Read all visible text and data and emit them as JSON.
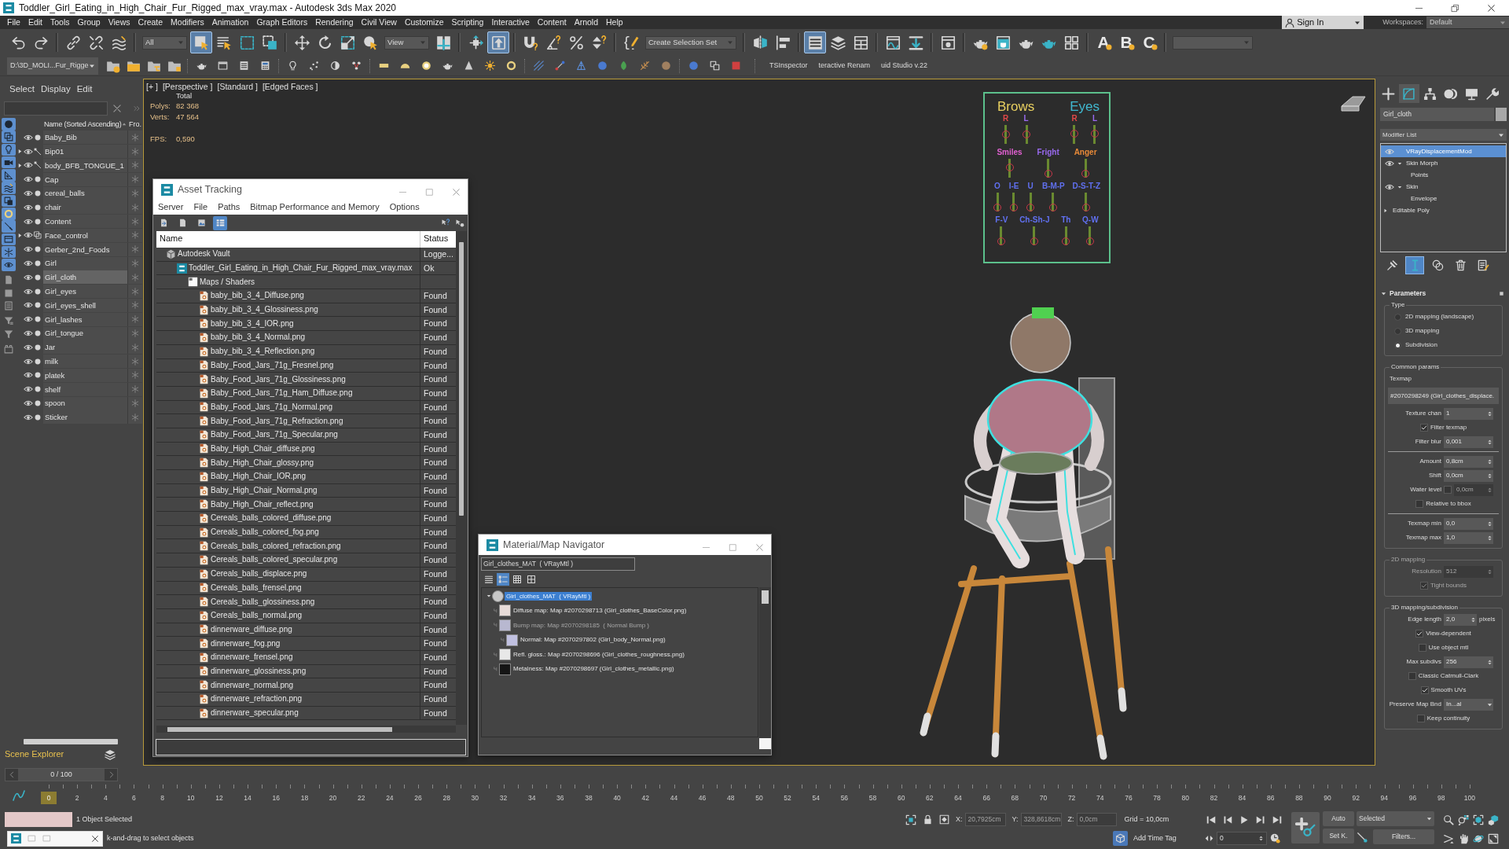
{
  "window": {
    "title": "Toddler_Girl_Eating_in_High_Chair_Fur_Rigged_max_vray.max - Autodesk 3ds Max 2020"
  },
  "menu": [
    "File",
    "Edit",
    "Tools",
    "Group",
    "Views",
    "Create",
    "Modifiers",
    "Animation",
    "Graph Editors",
    "Rendering",
    "Civil View",
    "Customize",
    "Scripting",
    "Interactive",
    "Content",
    "Arnold",
    "Help"
  ],
  "account": {
    "label": "Sign In"
  },
  "workspaces": {
    "label": "Workspaces:",
    "value": "Default"
  },
  "main_toolbar": [
    [
      {
        "kind": "undo",
        "on": false
      },
      {
        "kind": "redo",
        "on": false
      }
    ],
    [
      {
        "kind": "link",
        "on": false
      },
      {
        "kind": "unlink",
        "on": false
      },
      {
        "kind": "bind",
        "on": false
      }
    ],
    [
      {
        "kind": "dropdown",
        "value": "All",
        "on": false
      },
      {
        "kind": "select-object",
        "on": true
      },
      {
        "kind": "select-by-name",
        "on": false
      },
      {
        "kind": "region",
        "on": false
      },
      {
        "kind": "crossing",
        "on": false
      }
    ],
    [
      {
        "kind": "move",
        "on": false
      },
      {
        "kind": "rotate",
        "on": false
      },
      {
        "kind": "scale",
        "on": false
      },
      {
        "kind": "place",
        "on": false
      },
      {
        "kind": "dropdown",
        "value": "View",
        "on": false
      },
      {
        "kind": "pivot",
        "on": false
      }
    ],
    [
      {
        "kind": "manipulate",
        "on": false
      },
      {
        "kind": "shortcut-override",
        "on": true
      }
    ],
    [
      {
        "kind": "snap",
        "on": false
      },
      {
        "kind": "angle-snap",
        "on": false
      },
      {
        "kind": "percent-snap",
        "on": false
      },
      {
        "kind": "spinner-snap",
        "on": false
      }
    ],
    [
      {
        "kind": "named-selection",
        "on": false
      },
      {
        "kind": "dropdown",
        "value": "Create Selection Set",
        "on": false
      }
    ],
    [
      {
        "kind": "mirror",
        "on": false
      },
      {
        "kind": "align",
        "on": false
      }
    ],
    [
      {
        "kind": "scene-explorer",
        "on": true
      },
      {
        "kind": "layer-explorer",
        "on": false
      },
      {
        "kind": "ribbon",
        "on": false
      }
    ],
    [
      {
        "kind": "curve-editor",
        "on": false
      },
      {
        "kind": "schematic",
        "on": false
      }
    ],
    [
      {
        "kind": "material-editor",
        "on": false
      }
    ],
    [
      {
        "kind": "render-setup",
        "on": false
      },
      {
        "kind": "frame-window",
        "on": false
      },
      {
        "kind": "render",
        "on": false
      },
      {
        "kind": "render-iterative",
        "on": false
      },
      {
        "kind": "render-grid",
        "on": false
      }
    ],
    [
      {
        "kind": "preset",
        "label": "A",
        "on": false
      },
      {
        "kind": "preset",
        "label": "B",
        "on": false
      },
      {
        "kind": "preset",
        "label": "C",
        "on": false
      }
    ],
    [
      {
        "kind": "dropdown",
        "on": false
      }
    ]
  ],
  "secondary_toolbar": {
    "project": "D:\\3D_MOLI...Fur_Rigge",
    "groups": [
      [
        {
          "kind": "folder-gear"
        },
        {
          "kind": "folder"
        },
        {
          "kind": "folder-tree"
        },
        {
          "kind": "folder-tag"
        }
      ],
      [
        {
          "kind": "teapot"
        },
        {
          "kind": "window"
        },
        {
          "kind": "list"
        },
        {
          "kind": "calculator"
        }
      ],
      [
        {
          "kind": "bulb"
        },
        {
          "kind": "scatter"
        },
        {
          "kind": "half-circle"
        },
        {
          "kind": "nodes"
        }
      ],
      [
        {
          "kind": "bar"
        },
        {
          "kind": "dome"
        },
        {
          "kind": "sphere"
        },
        {
          "kind": "teapot"
        },
        {
          "kind": "cone"
        },
        {
          "kind": "sun"
        },
        {
          "kind": "ring"
        }
      ],
      [
        {
          "kind": "grid-dots"
        },
        {
          "kind": "molecule"
        },
        {
          "kind": "network"
        },
        {
          "kind": "ball"
        },
        {
          "kind": "leaf"
        },
        {
          "kind": "feather"
        },
        {
          "kind": "globe"
        }
      ],
      [
        {
          "kind": "ball"
        },
        {
          "kind": "windows"
        },
        {
          "kind": "square-dot"
        }
      ]
    ],
    "labels": [
      "TSInspector",
      "teractive Renam",
      "uid Studio v.22"
    ]
  },
  "scene_explorer": {
    "tabs": [
      "Select",
      "Display",
      "Edit"
    ],
    "columns": [
      "Name (Sorted Ascending)",
      "Fro."
    ],
    "filters": [
      [
        {
          "kind": "circle",
          "on": true
        },
        {
          "kind": "squares",
          "on": true
        },
        {
          "kind": "bulb",
          "on": true
        },
        {
          "kind": "camera",
          "on": true
        },
        {
          "kind": "ruler",
          "on": true
        },
        {
          "kind": "waves",
          "on": true
        },
        {
          "kind": "group-box",
          "on": true
        },
        {
          "kind": "ring",
          "on": true
        },
        {
          "kind": "pencil",
          "on": true
        },
        {
          "kind": "tray",
          "on": true
        },
        {
          "kind": "snowflake",
          "on": true
        },
        {
          "kind": "eye",
          "on": true
        }
      ],
      [
        {
          "kind": "document",
          "on": false
        },
        {
          "kind": "square",
          "on": false
        },
        {
          "kind": "doc-lines",
          "on": false
        }
      ],
      [
        {
          "kind": "funnel-lines",
          "on": false
        },
        {
          "kind": "funnel",
          "on": false
        }
      ],
      [
        {
          "kind": "container",
          "on": false
        }
      ]
    ],
    "items": [
      {
        "name": "Baby_Bib",
        "kind": "geometry",
        "expandable": false,
        "selected": false
      },
      {
        "name": "Bip01",
        "kind": "bone",
        "expandable": true,
        "selected": false
      },
      {
        "name": "body_BFB_TONGUE_1",
        "kind": "bone",
        "expandable": true,
        "selected": false
      },
      {
        "name": "Cap",
        "kind": "geometry",
        "expandable": false,
        "selected": false
      },
      {
        "name": "cereal_balls",
        "kind": "geometry",
        "expandable": false,
        "selected": false
      },
      {
        "name": "chair",
        "kind": "geometry",
        "expandable": false,
        "selected": false
      },
      {
        "name": "Content",
        "kind": "geometry",
        "expandable": false,
        "selected": false
      },
      {
        "name": "Face_control",
        "kind": "shape",
        "expandable": true,
        "selected": false
      },
      {
        "name": "Gerber_2nd_Foods",
        "kind": "geometry",
        "expandable": false,
        "selected": false
      },
      {
        "name": "Girl",
        "kind": "geometry",
        "expandable": false,
        "selected": false
      },
      {
        "name": "Girl_cloth",
        "kind": "geometry",
        "expandable": false,
        "selected": true
      },
      {
        "name": "Girl_eyes",
        "kind": "geometry",
        "expandable": false,
        "selected": false
      },
      {
        "name": "Girl_eyes_shell",
        "kind": "geometry",
        "expandable": false,
        "selected": false
      },
      {
        "name": "Girl_lashes",
        "kind": "geometry",
        "expandable": false,
        "selected": false
      },
      {
        "name": "Girl_tongue",
        "kind": "geometry",
        "expandable": false,
        "selected": false
      },
      {
        "name": "Jar",
        "kind": "geometry",
        "expandable": false,
        "selected": false
      },
      {
        "name": "milk",
        "kind": "geometry",
        "expandable": false,
        "selected": false
      },
      {
        "name": "platek",
        "kind": "geometry",
        "expandable": false,
        "selected": false
      },
      {
        "name": "shelf",
        "kind": "geometry",
        "expandable": false,
        "selected": false
      },
      {
        "name": "spoon",
        "kind": "geometry",
        "expandable": false,
        "selected": false
      },
      {
        "name": "Sticker",
        "kind": "geometry",
        "expandable": false,
        "selected": false
      }
    ],
    "title": "Scene Explorer"
  },
  "viewport": {
    "labels": [
      "[+ ]",
      "[Perspective ]",
      "[Standard ]",
      "[Edged Faces ]"
    ],
    "stats": {
      "title": "Total",
      "rows": [
        {
          "label": "Polys:",
          "value": "82 368"
        },
        {
          "label": "Verts:",
          "value": "47 564"
        }
      ],
      "fps": {
        "label": "FPS:",
        "value": "0,590"
      }
    },
    "face_board": {
      "groups": [
        {
          "label": "Brows",
          "color": "#e8d060",
          "controls": [
            {
              "label": "R",
              "color": "#e04848",
              "level": 0.5
            },
            {
              "label": "L",
              "color": "#9a6af0",
              "level": 0.5
            }
          ]
        },
        {
          "label": "Eyes",
          "color": "#40b8d0",
          "controls": [
            {
              "label": "R",
              "color": "#e04848",
              "level": 0.55
            },
            {
              "label": "L",
              "color": "#9a6af0",
              "level": 0.55
            }
          ]
        }
      ],
      "lines": [
        {
          "controls": [
            {
              "label": "Smiles",
              "color": "#e060d0",
              "level": 0.55
            },
            {
              "label": "Fright",
              "color": "#9a6af0",
              "level": 0
            },
            {
              "label": "Anger",
              "color": "#e88a38",
              "level": 0
            }
          ]
        },
        {
          "controls": [
            {
              "label": "O",
              "color": "#6070f0",
              "level": 0
            },
            {
              "label": "I-E",
              "color": "#6070f0",
              "level": 0
            },
            {
              "label": "U",
              "color": "#6070f0",
              "level": 0
            },
            {
              "label": "B-M-P",
              "color": "#6070f0",
              "level": 0
            },
            {
              "label": "D-S-T-Z",
              "color": "#6070f0",
              "level": 0
            }
          ]
        },
        {
          "controls": [
            {
              "label": "F-V",
              "color": "#6070f0",
              "level": 0
            },
            {
              "label": "Ch-Sh-J",
              "color": "#6070f0",
              "level": 0
            },
            {
              "label": "Th",
              "color": "#6070f0",
              "level": 0
            },
            {
              "label": "Q-W",
              "color": "#6070f0",
              "level": 0
            }
          ]
        }
      ]
    }
  },
  "asset_tracking": {
    "title": "Asset Tracking",
    "menu": [
      "Server",
      "File",
      "Paths",
      "Bitmap Performance and Memory",
      "Options"
    ],
    "toolbar": [
      {
        "kind": "doc-arrow",
        "on": false
      },
      {
        "kind": "doc",
        "on": false
      },
      {
        "kind": "picture",
        "on": false
      },
      {
        "kind": "table",
        "on": true
      }
    ],
    "columns": [
      "Name",
      "Status"
    ],
    "rows": [
      {
        "kind": "vault",
        "name": "Autodesk Vault",
        "status": "Logge...",
        "children": [
          {
            "kind": "scene",
            "name": "Toddler_Girl_Eating_in_High_Chair_Fur_Rigged_max_vray.max",
            "status": "Ok",
            "children": [
              {
                "kind": "folder",
                "name": "Maps / Shaders",
                "children": [
                  {
                    "kind": "bitmap",
                    "name": "baby_bib_3_4_Diffuse.png",
                    "status": "Found"
                  },
                  {
                    "kind": "bitmap",
                    "name": "baby_bib_3_4_Glossiness.png",
                    "status": "Found"
                  },
                  {
                    "kind": "bitmap",
                    "name": "baby_bib_3_4_IOR.png",
                    "status": "Found"
                  },
                  {
                    "kind": "bitmap",
                    "name": "baby_bib_3_4_Normal.png",
                    "status": "Found"
                  },
                  {
                    "kind": "bitmap",
                    "name": "baby_bib_3_4_Reflection.png",
                    "status": "Found"
                  },
                  {
                    "kind": "bitmap",
                    "name": "Baby_Food_Jars_71g_Fresnel.png",
                    "status": "Found"
                  },
                  {
                    "kind": "bitmap",
                    "name": "Baby_Food_Jars_71g_Glossiness.png",
                    "status": "Found"
                  },
                  {
                    "kind": "bitmap",
                    "name": "Baby_Food_Jars_71g_Ham_Diffuse.png",
                    "status": "Found"
                  },
                  {
                    "kind": "bitmap",
                    "name": "Baby_Food_Jars_71g_Normal.png",
                    "status": "Found"
                  },
                  {
                    "kind": "bitmap",
                    "name": "Baby_Food_Jars_71g_Refraction.png",
                    "status": "Found"
                  },
                  {
                    "kind": "bitmap",
                    "name": "Baby_Food_Jars_71g_Specular.png",
                    "status": "Found"
                  },
                  {
                    "kind": "bitmap",
                    "name": "Baby_High_Chair_diffuse.png",
                    "status": "Found"
                  },
                  {
                    "kind": "bitmap",
                    "name": "Baby_High_Chair_glossy.png",
                    "status": "Found"
                  },
                  {
                    "kind": "bitmap",
                    "name": "Baby_High_Chair_IOR.png",
                    "status": "Found"
                  },
                  {
                    "kind": "bitmap",
                    "name": "Baby_High_Chair_Normal.png",
                    "status": "Found"
                  },
                  {
                    "kind": "bitmap",
                    "name": "Baby_High_Chair_reflect.png",
                    "status": "Found"
                  },
                  {
                    "kind": "bitmap",
                    "name": "Cereals_balls_colored_diffuse.png",
                    "status": "Found"
                  },
                  {
                    "kind": "bitmap",
                    "name": "Cereals_balls_colored_fog.png",
                    "status": "Found"
                  },
                  {
                    "kind": "bitmap",
                    "name": "Cereals_balls_colored_refraction.png",
                    "status": "Found"
                  },
                  {
                    "kind": "bitmap",
                    "name": "Cereals_balls_colored_specular.png",
                    "status": "Found"
                  },
                  {
                    "kind": "bitmap",
                    "name": "Cereals_balls_displace.png",
                    "status": "Found"
                  },
                  {
                    "kind": "bitmap",
                    "name": "Cereals_balls_frensel.png",
                    "status": "Found"
                  },
                  {
                    "kind": "bitmap",
                    "name": "Cereals_balls_glossiness.png",
                    "status": "Found"
                  },
                  {
                    "kind": "bitmap",
                    "name": "Cereals_balls_normal.png",
                    "status": "Found"
                  },
                  {
                    "kind": "bitmap",
                    "name": "dinnerware_diffuse.png",
                    "status": "Found"
                  },
                  {
                    "kind": "bitmap",
                    "name": "dinnerware_fog.png",
                    "status": "Found"
                  },
                  {
                    "kind": "bitmap",
                    "name": "dinnerware_frensel.png",
                    "status": "Found"
                  },
                  {
                    "kind": "bitmap",
                    "name": "dinnerware_glossiness.png",
                    "status": "Found"
                  },
                  {
                    "kind": "bitmap",
                    "name": "dinnerware_normal.png",
                    "status": "Found"
                  },
                  {
                    "kind": "bitmap",
                    "name": "dinnerware_refraction.png",
                    "status": "Found"
                  },
                  {
                    "kind": "bitmap",
                    "name": "dinnerware_specular.png",
                    "status": "Found"
                  }
                ]
              }
            ]
          }
        ]
      }
    ]
  },
  "material_navigator": {
    "title": "Material/Map Navigator",
    "field": "Girl_clothes_MAT  ( VRayMtl )",
    "views": [
      {
        "kind": "lines",
        "selected": false
      },
      {
        "kind": "thumb-lines",
        "selected": true
      },
      {
        "kind": "grid-small",
        "selected": false
      },
      {
        "kind": "grid-large",
        "selected": false
      }
    ],
    "tree": [
      {
        "label": "Girl_clothes_MAT  ( VRayMtl )",
        "kind": "material",
        "color": "#c8c8c8",
        "selected": true,
        "disabled": false,
        "children": [
          {
            "label": "Diffuse map: Map #2070298713 (Girl_clothes_BaseColor.png)",
            "kind": "map",
            "color": "#e8dcd8",
            "selected": false,
            "disabled": false
          },
          {
            "label": "Bump map: Map #2070298185  ( Normal Bump )",
            "kind": "map",
            "color": "#b8b8d0",
            "selected": false,
            "disabled": true,
            "children": [
              {
                "label": "Normal: Map #2070297802 (Girl_body_Normal.png)",
                "kind": "map",
                "color": "#c0c0e0",
                "selected": false,
                "disabled": false
              }
            ]
          },
          {
            "label": "Refl. gloss.: Map #2070298696 (Girl_clothes_roughness.png)",
            "kind": "map",
            "color": "#e8e8e8",
            "selected": false,
            "disabled": false
          },
          {
            "label": "Metalness: Map #2070298697 (Girl_clothes_metallic.png)",
            "kind": "map",
            "color": "#151515",
            "selected": false,
            "disabled": false
          }
        ]
      }
    ]
  },
  "command_panel": {
    "tabs": [
      {
        "kind": "create",
        "selected": false
      },
      {
        "kind": "modify",
        "selected": true
      },
      {
        "kind": "hierarchy",
        "selected": false
      },
      {
        "kind": "motion",
        "selected": false
      },
      {
        "kind": "display",
        "selected": false
      },
      {
        "kind": "utilities",
        "selected": false
      }
    ],
    "object_name": "Girl_cloth",
    "modifier_list": "Modifier List",
    "stack": [
      {
        "kind": "modifier",
        "label": "VRayDisplacementMod",
        "selected": true
      },
      {
        "kind": "modifier",
        "label": "Skin Morph",
        "selected": false,
        "expanded": true,
        "children": [
          {
            "kind": "subobject",
            "label": "Points",
            "selected": false
          }
        ]
      },
      {
        "kind": "modifier",
        "label": "Skin",
        "selected": false,
        "expanded": true,
        "children": [
          {
            "kind": "subobject",
            "label": "Envelope",
            "selected": false
          }
        ]
      },
      {
        "kind": "base",
        "label": "Editable Poly",
        "selected": false,
        "expanded": false
      }
    ],
    "stack_tools": [
      {
        "kind": "pin",
        "on": false
      },
      {
        "kind": "end-result",
        "on": true
      },
      {
        "kind": "make-unique",
        "on": false
      },
      {
        "kind": "remove",
        "on": false
      },
      {
        "kind": "configure",
        "on": false
      }
    ],
    "rollout": {
      "title": "Parameters",
      "expanded": true,
      "groups": [
        {
          "title": "Type",
          "disabled": false,
          "sections": [
            [
              {
                "kind": "radio",
                "label": "2D mapping (landscape)",
                "selected": false
              },
              {
                "kind": "radio",
                "label": "3D mapping",
                "selected": false
              },
              {
                "kind": "radio",
                "label": "Subdivision",
                "selected": true
              }
            ]
          ]
        },
        {
          "title": "Common params",
          "disabled": false,
          "sections": [
            [
              {
                "kind": "label",
                "text": "Texmap"
              },
              {
                "kind": "map",
                "value": "#2070298249 (Girl_clothes_displace."
              },
              {
                "kind": "spinner",
                "label": "Texture chan",
                "value": "1"
              },
              {
                "kind": "checkbox",
                "label": "Filter texmap",
                "checked": true
              },
              {
                "kind": "spinner",
                "label": "Filter blur",
                "value": "0,001"
              }
            ],
            [
              {
                "kind": "spinner",
                "label": "Amount",
                "value": "0,8cm"
              },
              {
                "kind": "spinner",
                "label": "Shift",
                "value": "0,0cm"
              },
              {
                "kind": "spinner",
                "label": "Water level",
                "value": "0,0cm",
                "disabled": true,
                "toggle": {
                  "checked": false
                }
              },
              {
                "kind": "checkbox",
                "label": "Relative to bbox",
                "checked": false
              }
            ],
            [
              {
                "kind": "spinner",
                "label": "Texmap min",
                "value": "0,0"
              },
              {
                "kind": "spinner",
                "label": "Texmap max",
                "value": "1,0"
              }
            ]
          ]
        },
        {
          "title": "2D mapping",
          "disabled": true,
          "sections": [
            [
              {
                "kind": "spinner",
                "label": "Resolution",
                "value": "512"
              },
              {
                "kind": "checkbox",
                "label": "Tight bounds",
                "checked": true
              }
            ]
          ]
        },
        {
          "title": "3D mapping/subdivision",
          "disabled": false,
          "sections": [
            [
              {
                "kind": "spinner",
                "label": "Edge length",
                "value": "2,0",
                "unit": "pixels"
              },
              {
                "kind": "checkbox",
                "label": "View-dependent",
                "checked": true
              },
              {
                "kind": "checkbox",
                "label": "Use object mtl",
                "checked": false
              },
              {
                "kind": "spinner",
                "label": "Max subdivs",
                "value": "256"
              },
              {
                "kind": "checkbox",
                "label": "Classic Catmull-Clark",
                "checked": false
              },
              {
                "kind": "checkbox",
                "label": "Smooth UVs",
                "checked": true
              },
              {
                "kind": "dropdown",
                "label": "Preserve Map Bnd",
                "value": "In...al"
              },
              {
                "kind": "checkbox",
                "label": "Keep continuity",
                "checked": false
              }
            ]
          ]
        }
      ]
    }
  },
  "time_slider": {
    "label": "0 / 100"
  },
  "track_bar": {
    "ticks": [
      {
        "label": "0",
        "selected": true
      },
      {
        "label": "2",
        "selected": false
      },
      {
        "label": "4",
        "selected": false
      },
      {
        "label": "6",
        "selected": false
      },
      {
        "label": "8",
        "selected": false
      },
      {
        "label": "10",
        "selected": false
      },
      {
        "label": "12",
        "selected": false
      },
      {
        "label": "14",
        "selected": false
      },
      {
        "label": "16",
        "selected": false
      },
      {
        "label": "18",
        "selected": false
      },
      {
        "label": "20",
        "selected": false
      },
      {
        "label": "22",
        "selected": false
      },
      {
        "label": "24",
        "selected": false
      },
      {
        "label": "26",
        "selected": false
      },
      {
        "label": "28",
        "selected": false
      },
      {
        "label": "30",
        "selected": false
      },
      {
        "label": "32",
        "selected": false
      },
      {
        "label": "34",
        "selected": false
      },
      {
        "label": "36",
        "selected": false
      },
      {
        "label": "38",
        "selected": false
      },
      {
        "label": "40",
        "selected": false
      },
      {
        "label": "42",
        "selected": false
      },
      {
        "label": "44",
        "selected": false
      },
      {
        "label": "46",
        "selected": false
      },
      {
        "label": "48",
        "selected": false
      },
      {
        "label": "50",
        "selected": false
      },
      {
        "label": "52",
        "selected": false
      },
      {
        "label": "54",
        "selected": false
      },
      {
        "label": "56",
        "selected": false
      },
      {
        "label": "58",
        "selected": false
      },
      {
        "label": "60",
        "selected": false
      },
      {
        "label": "62",
        "selected": false
      },
      {
        "label": "64",
        "selected": false
      },
      {
        "label": "66",
        "selected": false
      },
      {
        "label": "68",
        "selected": false
      },
      {
        "label": "70",
        "selected": false
      },
      {
        "label": "72",
        "selected": false
      },
      {
        "label": "74",
        "selected": false
      },
      {
        "label": "76",
        "selected": false
      },
      {
        "label": "78",
        "selected": false
      },
      {
        "label": "80",
        "selected": false
      },
      {
        "label": "82",
        "selected": false
      },
      {
        "label": "84",
        "selected": false
      },
      {
        "label": "86",
        "selected": false
      },
      {
        "label": "88",
        "selected": false
      },
      {
        "label": "90",
        "selected": false
      },
      {
        "label": "92",
        "selected": false
      },
      {
        "label": "94",
        "selected": false
      },
      {
        "label": "96",
        "selected": false
      },
      {
        "label": "98",
        "selected": false
      },
      {
        "label": "100",
        "selected": false
      }
    ]
  },
  "status_bar": {
    "selection": "1 Object Selected",
    "prompt": "k-and-drag to select objects",
    "coordinates": [
      {
        "label": "X:",
        "value": "20,7925cm",
        "disabled": true
      },
      {
        "label": "Y:",
        "value": "328,8618cm",
        "disabled": true
      },
      {
        "label": "Z:",
        "value": "0,0cm",
        "disabled": true
      }
    ],
    "grid": "Grid = 10,0cm",
    "time_tag": "Add Time Tag",
    "auto_key": {
      "label": "Auto",
      "on": false
    },
    "set_key": {
      "label": "Set K."
    },
    "key_filter": "Selected",
    "filters": "Filters...",
    "frame": "0"
  }
}
